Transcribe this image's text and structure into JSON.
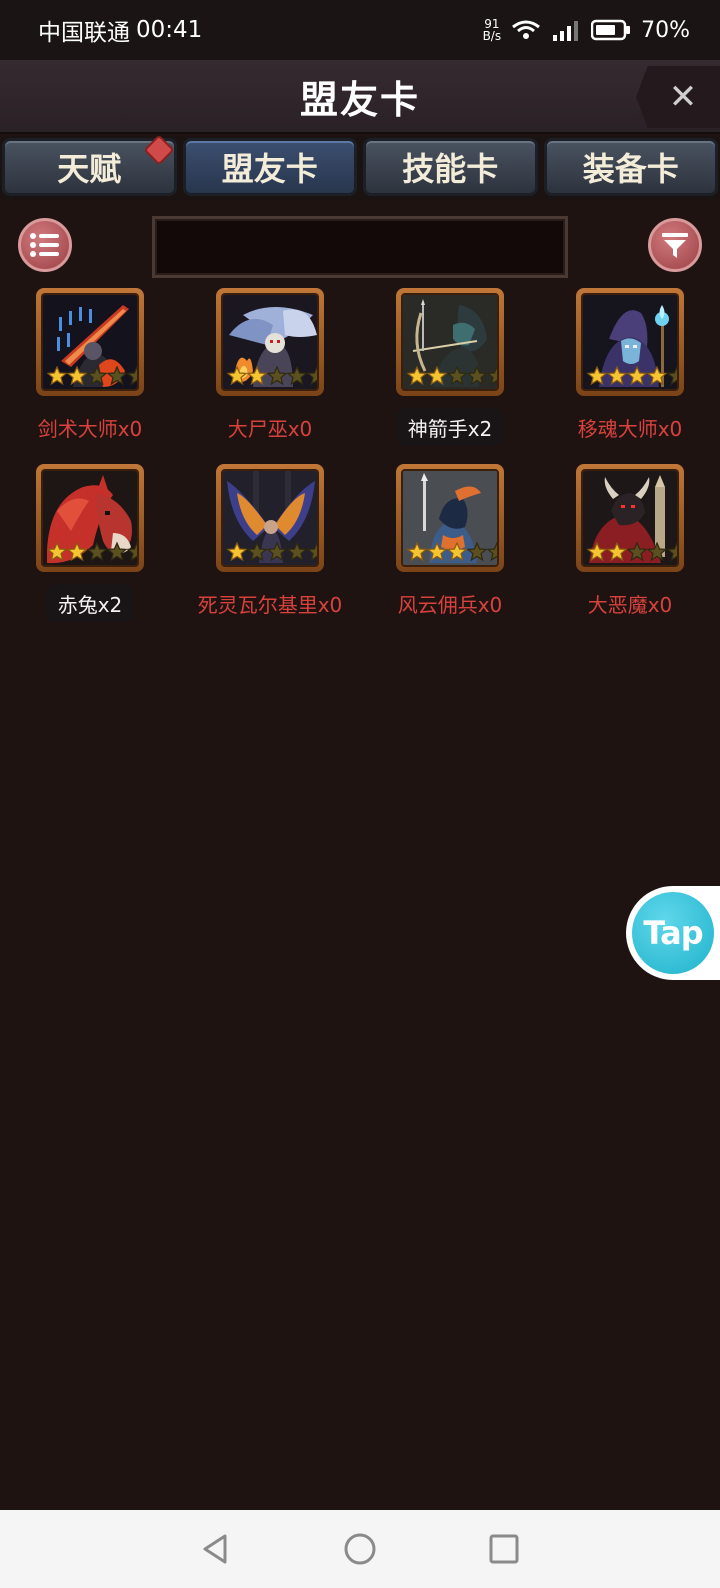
{
  "status_bar": {
    "carrier": "中国联通",
    "time": "00:41",
    "speed_value": "91",
    "speed_unit": "B/s",
    "battery": "70%"
  },
  "header": {
    "title": "盟友卡",
    "close_glyph": "✕"
  },
  "tabs": [
    {
      "label": "天赋",
      "active": false,
      "badge": true
    },
    {
      "label": "盟友卡",
      "active": true,
      "badge": false
    },
    {
      "label": "技能卡",
      "active": false,
      "badge": false
    },
    {
      "label": "装备卡",
      "active": false,
      "badge": false
    }
  ],
  "toolbar": {
    "list_icon": "list-icon",
    "filter_icon": "filter-icon",
    "search_value": ""
  },
  "cards": [
    {
      "name": "剑术大师x0",
      "stars": 2,
      "owned": false
    },
    {
      "name": "大尸巫x0",
      "stars": 2,
      "owned": false
    },
    {
      "name": "神箭手x2",
      "stars": 2,
      "owned": true
    },
    {
      "name": "移魂大师x0",
      "stars": 4,
      "owned": false
    },
    {
      "name": "赤兔x2",
      "stars": 2,
      "owned": true
    },
    {
      "name": "死灵瓦尔基里x0",
      "stars": 1,
      "owned": false
    },
    {
      "name": "风云佣兵x0",
      "stars": 3,
      "owned": false
    },
    {
      "name": "大恶魔x0",
      "stars": 2,
      "owned": false
    }
  ],
  "floating": {
    "tap_label": "Tap"
  },
  "colors": {
    "background": "#1f1312",
    "not_owned_text": "#d8423c",
    "owned_text": "#f2f2f2",
    "star_filled": "#f5c531",
    "star_empty": "#5b5020",
    "card_frame": "#c07738"
  }
}
